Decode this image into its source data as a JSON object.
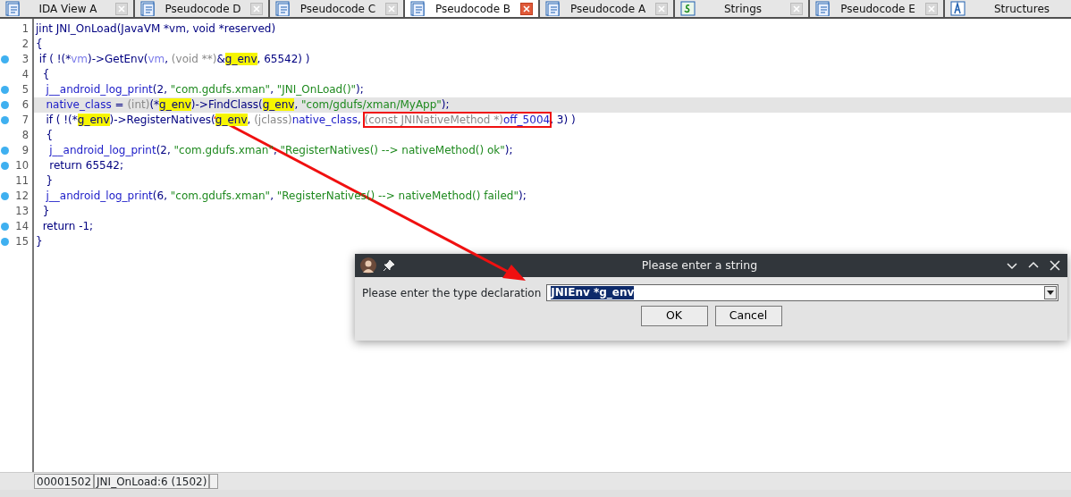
{
  "tabs": [
    {
      "label": "IDA View A",
      "kind": "pseudocode",
      "selected": false,
      "closable": true
    },
    {
      "label": "Pseudocode D",
      "kind": "pseudocode",
      "selected": false,
      "closable": true
    },
    {
      "label": "Pseudocode C",
      "kind": "pseudocode",
      "selected": false,
      "closable": true
    },
    {
      "label": "Pseudocode B",
      "kind": "pseudocode",
      "selected": true,
      "closable": true
    },
    {
      "label": "Pseudocode A",
      "kind": "pseudocode",
      "selected": false,
      "closable": true
    },
    {
      "label": "Strings",
      "kind": "strings",
      "selected": false,
      "closable": true
    },
    {
      "label": "Pseudocode E",
      "kind": "pseudocode",
      "selected": false,
      "closable": true
    },
    {
      "label": "Structures",
      "kind": "structures",
      "selected": false,
      "closable": false
    }
  ],
  "code": [
    {
      "num": "1",
      "breakpoint": false,
      "selected": false,
      "tokens": [
        {
          "t": "jint JNI_OnLoad(JavaVM *vm, void *reserved)",
          "kind": "plain"
        }
      ]
    },
    {
      "num": "2",
      "breakpoint": false,
      "selected": false,
      "tokens": [
        {
          "t": "{",
          "kind": "plain"
        }
      ]
    },
    {
      "num": "3",
      "breakpoint": true,
      "selected": false,
      "tokens": [
        {
          "t": " if ( !(*",
          "kind": "plain"
        },
        {
          "t": "vm",
          "kind": "var"
        },
        {
          "t": ")->GetEnv(",
          "kind": "plain"
        },
        {
          "t": "vm",
          "kind": "var"
        },
        {
          "t": ", ",
          "kind": "plain"
        },
        {
          "t": "(void **)",
          "kind": "cast"
        },
        {
          "t": "&",
          "kind": "plain"
        },
        {
          "t": "g_env",
          "kind": "hl"
        },
        {
          "t": ", 65542) )",
          "kind": "plain"
        }
      ]
    },
    {
      "num": "4",
      "breakpoint": false,
      "selected": false,
      "tokens": [
        {
          "t": "  {",
          "kind": "plain"
        }
      ]
    },
    {
      "num": "5",
      "breakpoint": true,
      "selected": false,
      "tokens": [
        {
          "t": "   j__android_log_print",
          "kind": "name"
        },
        {
          "t": "(2, ",
          "kind": "plain"
        },
        {
          "t": "\"com.gdufs.xman\"",
          "kind": "str"
        },
        {
          "t": ", ",
          "kind": "plain"
        },
        {
          "t": "\"JNI_OnLoad()\"",
          "kind": "str"
        },
        {
          "t": ");",
          "kind": "plain"
        }
      ]
    },
    {
      "num": "6",
      "breakpoint": true,
      "selected": true,
      "tokens": [
        {
          "t": "   native_class",
          "kind": "name"
        },
        {
          "t": " = ",
          "kind": "plain"
        },
        {
          "t": "(int)",
          "kind": "cast"
        },
        {
          "t": "(*",
          "kind": "plain"
        },
        {
          "t": "g_env",
          "kind": "hl"
        },
        {
          "t": ")->FindClass(",
          "kind": "plain"
        },
        {
          "t": "g_env",
          "kind": "hl"
        },
        {
          "t": ", ",
          "kind": "plain"
        },
        {
          "t": "\"com/gdufs/xman/MyApp\"",
          "kind": "str"
        },
        {
          "t": ");",
          "kind": "plain"
        }
      ]
    },
    {
      "num": "7",
      "breakpoint": true,
      "selected": false,
      "tokens": [
        {
          "t": "   if ( !(*",
          "kind": "plain"
        },
        {
          "t": "g_env",
          "kind": "hl"
        },
        {
          "t": ")->RegisterNatives(",
          "kind": "plain"
        },
        {
          "t": "g_env",
          "kind": "hl"
        },
        {
          "t": ", ",
          "kind": "plain"
        },
        {
          "t": "(jclass)",
          "kind": "cast"
        },
        {
          "t": "native_class",
          "kind": "name"
        },
        {
          "t": ", ",
          "kind": "plain"
        },
        {
          "t": "(const JNINativeMethod *)",
          "kind": "cast",
          "boxed": true
        },
        {
          "t": "off_5004",
          "kind": "name",
          "boxed": true
        },
        {
          "t": ", 3) )",
          "kind": "plain"
        }
      ]
    },
    {
      "num": "8",
      "breakpoint": false,
      "selected": false,
      "tokens": [
        {
          "t": "   {",
          "kind": "plain"
        }
      ]
    },
    {
      "num": "9",
      "breakpoint": true,
      "selected": false,
      "tokens": [
        {
          "t": "    j__android_log_print",
          "kind": "name"
        },
        {
          "t": "(2, ",
          "kind": "plain"
        },
        {
          "t": "\"com.gdufs.xman\"",
          "kind": "str"
        },
        {
          "t": ", ",
          "kind": "plain"
        },
        {
          "t": "\"RegisterNatives() --> nativeMethod() ok\"",
          "kind": "str"
        },
        {
          "t": ");",
          "kind": "plain"
        }
      ]
    },
    {
      "num": "10",
      "breakpoint": true,
      "selected": false,
      "tokens": [
        {
          "t": "    return 65542;",
          "kind": "plain"
        }
      ]
    },
    {
      "num": "11",
      "breakpoint": false,
      "selected": false,
      "tokens": [
        {
          "t": "   }",
          "kind": "plain"
        }
      ]
    },
    {
      "num": "12",
      "breakpoint": true,
      "selected": false,
      "tokens": [
        {
          "t": "   j__android_log_print",
          "kind": "name"
        },
        {
          "t": "(6, ",
          "kind": "plain"
        },
        {
          "t": "\"com.gdufs.xman\"",
          "kind": "str"
        },
        {
          "t": ", ",
          "kind": "plain"
        },
        {
          "t": "\"RegisterNatives() --> nativeMethod() failed\"",
          "kind": "str"
        },
        {
          "t": ");",
          "kind": "plain"
        }
      ]
    },
    {
      "num": "13",
      "breakpoint": false,
      "selected": false,
      "tokens": [
        {
          "t": "  }",
          "kind": "plain"
        }
      ]
    },
    {
      "num": "14",
      "breakpoint": true,
      "selected": false,
      "tokens": [
        {
          "t": "  return -1;",
          "kind": "plain"
        }
      ]
    },
    {
      "num": "15",
      "breakpoint": true,
      "selected": false,
      "tokens": [
        {
          "t": "}",
          "kind": "plain"
        }
      ]
    }
  ],
  "status_bar": [
    "00001502",
    "JNI_OnLoad:6 (1502)"
  ],
  "dialog": {
    "title": "Please enter a string",
    "label": "Please enter the type declaration",
    "value": "JNIEnv *g_env",
    "buttons": [
      "OK",
      "Cancel"
    ]
  }
}
